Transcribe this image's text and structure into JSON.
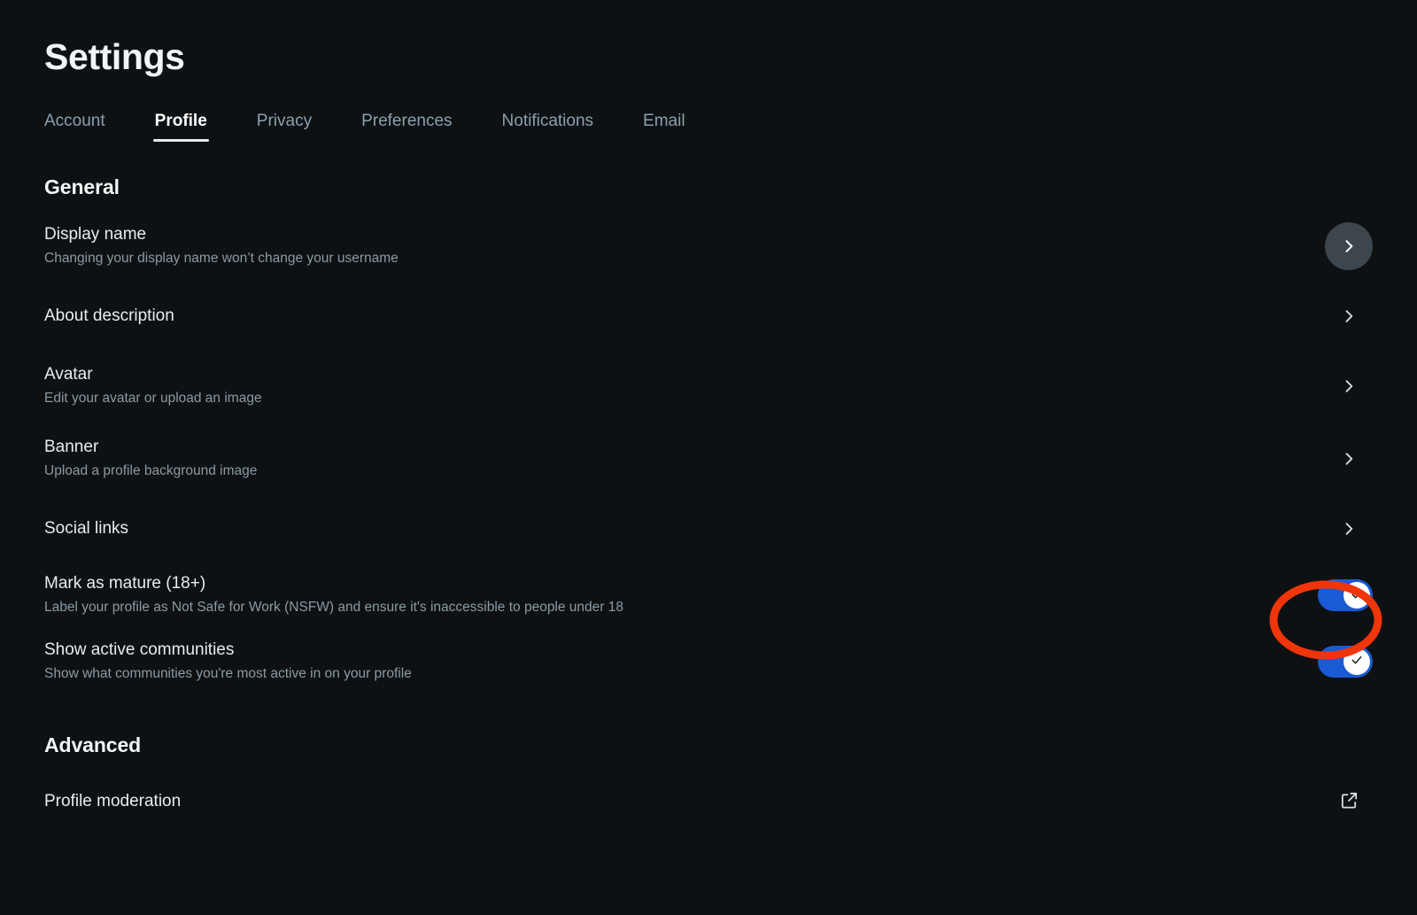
{
  "app": {
    "title": "Settings",
    "background_color": "#0e1113",
    "accent_color": "#1a5ad4",
    "annotation_color": "#f0350b"
  },
  "tabs": [
    {
      "label": "Account",
      "active": false
    },
    {
      "label": "Profile",
      "active": true
    },
    {
      "label": "Privacy",
      "active": false
    },
    {
      "label": "Preferences",
      "active": false
    },
    {
      "label": "Notifications",
      "active": false
    },
    {
      "label": "Email",
      "active": false
    }
  ],
  "sections": [
    {
      "heading": "General",
      "rows": [
        {
          "label": "Display name",
          "description": "Changing your display name won’t change your username",
          "control": "chevron",
          "icon": "chevron-right-icon",
          "hovered": true
        },
        {
          "label": "About description",
          "description": "",
          "control": "chevron",
          "icon": "chevron-right-icon",
          "hovered": false
        },
        {
          "label": "Avatar",
          "description": "Edit your avatar or upload an image",
          "control": "chevron",
          "icon": "chevron-right-icon",
          "hovered": false
        },
        {
          "label": "Banner",
          "description": "Upload a profile background image",
          "control": "chevron",
          "icon": "chevron-right-icon",
          "hovered": false
        },
        {
          "label": "Social links",
          "description": "",
          "control": "chevron",
          "icon": "chevron-right-icon",
          "hovered": false
        },
        {
          "label": "Mark as mature (18+)",
          "description": "Label your profile as Not Safe for Work (NSFW) and ensure it's inaccessible to people under 18",
          "control": "toggle",
          "icon": "toggle-check-icon",
          "toggle_on": true,
          "annotated": true
        },
        {
          "label": "Show active communities",
          "description": "Show what communities you're most active in on your profile",
          "control": "toggle",
          "icon": "toggle-check-icon",
          "toggle_on": true,
          "annotated": false
        }
      ]
    },
    {
      "heading": "Advanced",
      "rows": [
        {
          "label": "Profile moderation",
          "description": "",
          "control": "external-link",
          "icon": "external-link-icon",
          "hovered": false
        }
      ]
    }
  ]
}
